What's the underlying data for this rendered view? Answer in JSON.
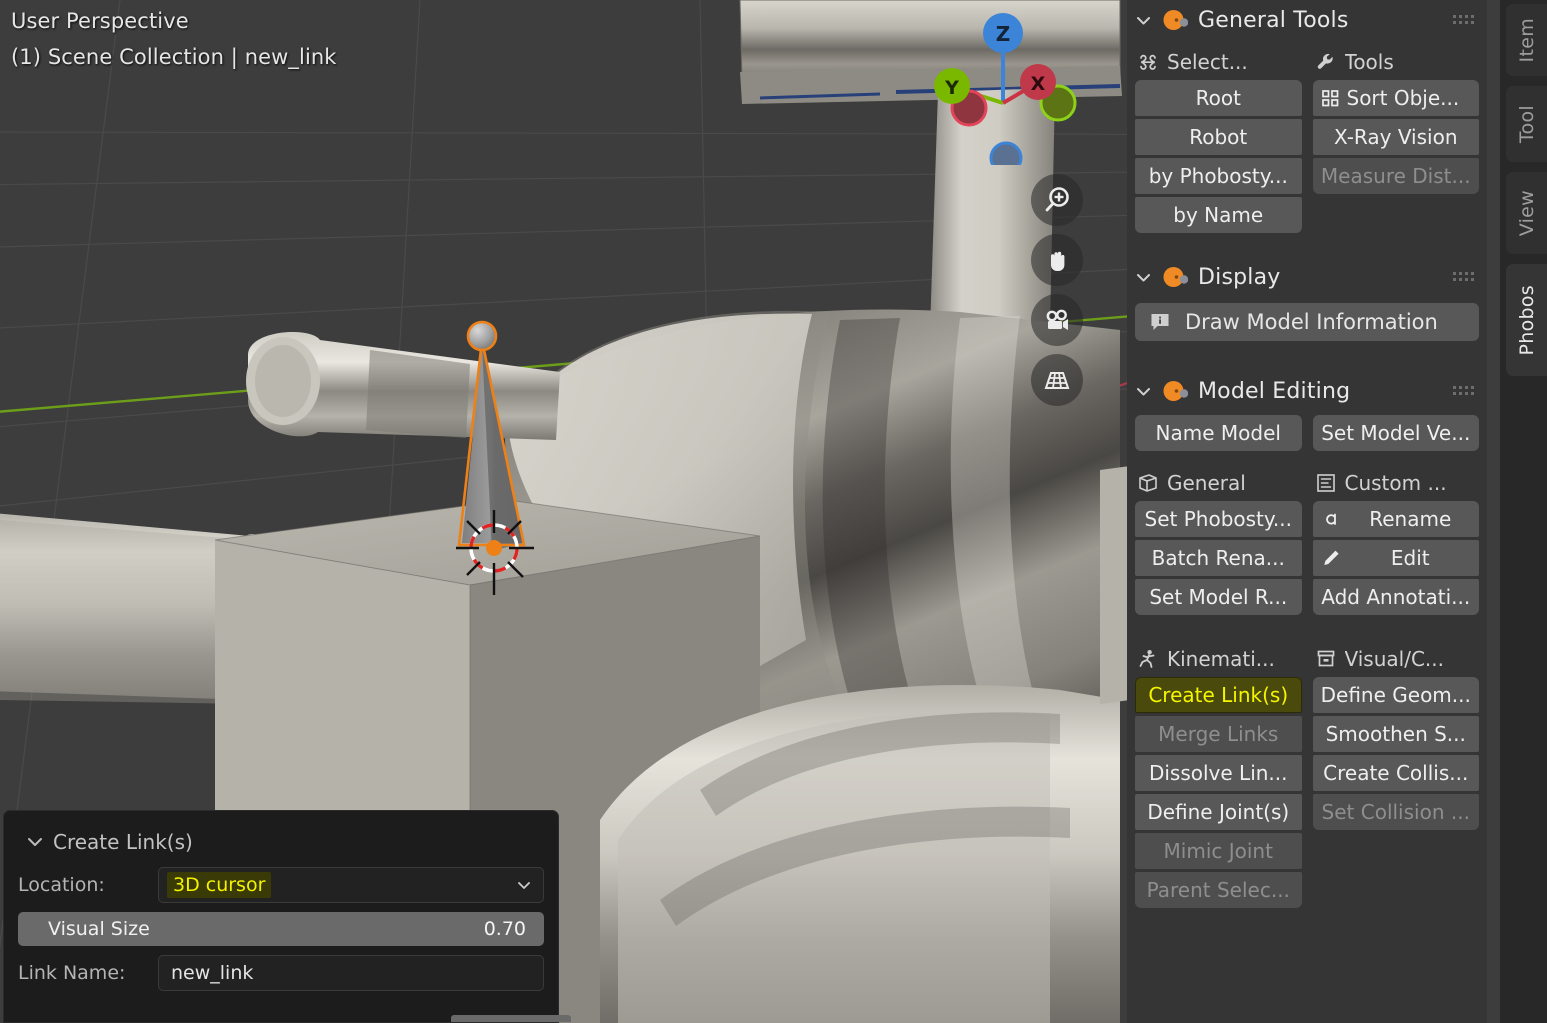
{
  "viewport": {
    "perspective_label": "User Perspective",
    "scene_label": "(1) Scene Collection | new_link",
    "gizmo": {
      "axis_z": "Z",
      "axis_y": "Y",
      "axis_x": "X",
      "color_x": "#cc3344",
      "color_y": "#7ab800",
      "color_z": "#3b84d8"
    },
    "nav_buttons": [
      {
        "name": "zoom-icon",
        "tooltip": "Zoom"
      },
      {
        "name": "hand-icon",
        "tooltip": "Move View"
      },
      {
        "name": "camera-icon",
        "tooltip": "Camera View"
      },
      {
        "name": "grid-icon",
        "tooltip": "Toggle Orthographic"
      }
    ]
  },
  "redo_panel": {
    "title": "Create Link(s)",
    "location_label": "Location:",
    "location_value": "3D cursor",
    "visual_size_label": "Visual Size",
    "visual_size_value": "0.70",
    "link_name_label": "Link Name:",
    "link_name_value": "new_link"
  },
  "npanel": {
    "sections": [
      {
        "title": "General Tools",
        "columns": [
          {
            "header": {
              "label": "Select...",
              "icon": "node-select-icon"
            },
            "buttons": [
              {
                "label": "Root",
                "state": "normal"
              },
              {
                "label": "Robot",
                "state": "normal"
              },
              {
                "label": "by Phobosty...",
                "state": "normal"
              },
              {
                "label": "by Name",
                "state": "normal"
              }
            ]
          },
          {
            "header": {
              "label": "Tools",
              "icon": "wrench-icon"
            },
            "buttons": [
              {
                "label": "Sort Obje...",
                "state": "normal",
                "icon": "grid-objects-icon"
              },
              {
                "label": "X-Ray Vision",
                "state": "normal"
              },
              {
                "label": "Measure Dist...",
                "state": "disabled"
              }
            ]
          }
        ]
      },
      {
        "title": "Display",
        "wide_buttons": [
          {
            "label": "Draw Model Information",
            "icon": "info-icon",
            "state": "normal"
          }
        ]
      },
      {
        "title": "Model Editing",
        "top_row": [
          {
            "label": "Name Model",
            "state": "normal"
          },
          {
            "label": "Set Model Ve...",
            "state": "normal"
          }
        ],
        "columns": [
          {
            "header": {
              "label": "General",
              "icon": "cube-icon"
            },
            "buttons": [
              {
                "label": "Set Phobosty...",
                "state": "normal"
              },
              {
                "label": "Batch Rena...",
                "state": "normal"
              },
              {
                "label": "Set Model R...",
                "state": "normal"
              }
            ]
          },
          {
            "header": {
              "label": "Custom ...",
              "icon": "text-lines-icon"
            },
            "buttons": [
              {
                "label": "Rename",
                "state": "normal",
                "icon": "font-a-icon"
              },
              {
                "label": "Edit",
                "state": "normal",
                "icon": "pencil-icon"
              },
              {
                "label": "Add Annotati...",
                "state": "normal"
              }
            ]
          }
        ],
        "columns2": [
          {
            "header": {
              "label": "Kinemati...",
              "icon": "pose-running-icon"
            },
            "buttons": [
              {
                "label": "Create Link(s)",
                "state": "active"
              },
              {
                "label": "Merge Links",
                "state": "disabled"
              },
              {
                "label": "Dissolve Lin...",
                "state": "normal"
              },
              {
                "label": "Define Joint(s)",
                "state": "normal"
              },
              {
                "label": "Mimic Joint",
                "state": "disabled"
              },
              {
                "label": "Parent Selec...",
                "state": "disabled"
              }
            ]
          },
          {
            "header": {
              "label": "Visual/C...",
              "icon": "archive-box-icon"
            },
            "buttons": [
              {
                "label": "Define Geom...",
                "state": "normal"
              },
              {
                "label": "Smoothen S...",
                "state": "normal"
              },
              {
                "label": "Create Collis...",
                "state": "normal"
              },
              {
                "label": "Set Collision ...",
                "state": "disabled"
              }
            ]
          }
        ]
      }
    ]
  },
  "tabs": [
    {
      "label": "Item",
      "active": false
    },
    {
      "label": "Tool",
      "active": false
    },
    {
      "label": "View",
      "active": false
    },
    {
      "label": "Phobos",
      "active": true
    }
  ]
}
